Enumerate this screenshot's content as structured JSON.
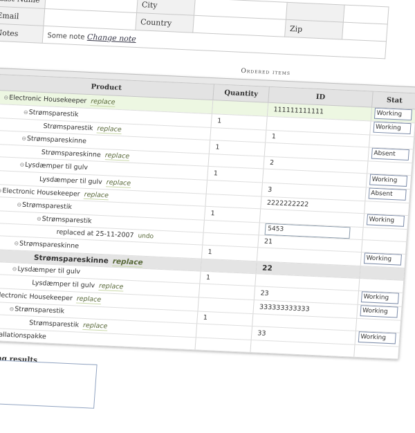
{
  "customer": {
    "row1": {
      "label_a": "Last Name",
      "label_b": "City"
    },
    "email_label": "Email",
    "country_label": "Country",
    "zip_label": "Zip",
    "notes_label": "Notes",
    "notes_text": "Some note",
    "change_note_link": "Change note"
  },
  "ordered_items": {
    "title": "Ordered items",
    "columns": {
      "product": "Product",
      "quantity": "Quantity",
      "id": "ID",
      "status": "Stat"
    },
    "rows": [
      {
        "indent": 0,
        "toggle": "⊖",
        "product": "Electronic Housekeeper",
        "action": "replace",
        "qty": "",
        "id": "111111111111",
        "status": "Working",
        "style": "first"
      },
      {
        "indent": 1,
        "toggle": "⊖",
        "product": "Strømsparestik",
        "action": "",
        "qty": "1",
        "id": "",
        "status": "Working",
        "style": ""
      },
      {
        "indent": 2,
        "toggle": "",
        "product": "Strømsparestik",
        "action": "replace",
        "qty": "",
        "id": "1",
        "status": "",
        "style": ""
      },
      {
        "indent": 1,
        "toggle": "⊖",
        "product": "Strømspareskinne",
        "action": "",
        "qty": "1",
        "id": "",
        "status": "Absent",
        "style": ""
      },
      {
        "indent": 2,
        "toggle": "",
        "product": "Strømspareskinne",
        "action": "replace",
        "qty": "",
        "id": "2",
        "status": "",
        "style": ""
      },
      {
        "indent": 1,
        "toggle": "⊖",
        "product": "Lysdæmper til gulv",
        "action": "",
        "qty": "1",
        "id": "",
        "status": "Working",
        "style": ""
      },
      {
        "indent": 2,
        "toggle": "",
        "product": "Lysdæmper til gulv",
        "action": "replace",
        "qty": "",
        "id": "3",
        "status": "Absent",
        "style": ""
      },
      {
        "indent": 0,
        "toggle": "⊖",
        "product": "Electronic Housekeeper",
        "action": "replace",
        "qty": "",
        "id": "2222222222",
        "status": "",
        "style": ""
      },
      {
        "indent": 1,
        "toggle": "⊖",
        "product": "Strømsparestik",
        "action": "",
        "qty": "1",
        "id": "",
        "status": "Working",
        "style": ""
      },
      {
        "indent": 2,
        "toggle": "⊖",
        "product": "Strømsparestik",
        "action": "",
        "qty": "",
        "id": "5453",
        "status": "",
        "style": "",
        "id_input": true
      },
      {
        "indent": 3,
        "toggle": "",
        "product": "replaced at 25-11-2007",
        "action": "undo",
        "qty": "",
        "id": "21",
        "status": "",
        "style": ""
      },
      {
        "indent": 1,
        "toggle": "⊖",
        "product": "Strømspareskinne",
        "action": "",
        "qty": "1",
        "id": "",
        "status": "Working",
        "style": ""
      },
      {
        "indent": 2,
        "toggle": "",
        "product": "Strømspareskinne",
        "action": "replace",
        "qty": "",
        "id": "22",
        "status": "",
        "style": "bold"
      },
      {
        "indent": 1,
        "toggle": "⊖",
        "product": "Lysdæmper til gulv",
        "action": "",
        "qty": "1",
        "id": "",
        "status": "",
        "style": ""
      },
      {
        "indent": 2,
        "toggle": "",
        "product": "Lysdæmper til gulv",
        "action": "replace",
        "qty": "",
        "id": "23",
        "status": "Working",
        "style": ""
      },
      {
        "indent": 0,
        "toggle": "⊖",
        "product": "Electronic Housekeeper",
        "action": "replace",
        "qty": "",
        "id": "333333333333",
        "status": "Working",
        "style": ""
      },
      {
        "indent": 1,
        "toggle": "⊖",
        "product": "Strømsparestik",
        "action": "",
        "qty": "1",
        "id": "",
        "status": "",
        "style": ""
      },
      {
        "indent": 2,
        "toggle": "",
        "product": "Strømsparestik",
        "action": "replace",
        "qty": "",
        "id": "33",
        "status": "Working",
        "style": ""
      },
      {
        "indent": 0,
        "toggle": "",
        "product": "Installationspakke",
        "action": "",
        "qty": "",
        "id": "",
        "status": "",
        "style": ""
      }
    ]
  },
  "testing_results": {
    "label": "Testing results",
    "value": ""
  }
}
